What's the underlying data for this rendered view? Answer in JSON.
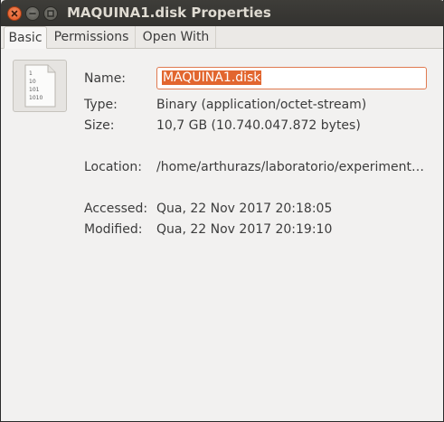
{
  "window": {
    "title": "MAQUINA1.disk Properties"
  },
  "tabs": [
    {
      "label": "Basic",
      "active": true
    },
    {
      "label": "Permissions",
      "active": false
    },
    {
      "label": "Open With",
      "active": false
    }
  ],
  "file_icon": {
    "icon": "binary-file-icon",
    "lines": [
      "1",
      "10",
      "101",
      "1010"
    ]
  },
  "properties": {
    "name_label": "Name:",
    "name_value": "MAQUINA1.disk",
    "type_label": "Type:",
    "type_value": "Binary (application/octet-stream)",
    "size_label": "Size:",
    "size_value": "10,7 GB (10.740.047.872 bytes)",
    "location_label": "Location:",
    "location_value": "/home/arthurazs/laboratorio/experiment…",
    "accessed_label": "Accessed:",
    "accessed_value": "Qua, 22 Nov 2017 20:18:05",
    "modified_label": "Modified:",
    "modified_value": "Qua, 22 Nov 2017 20:19:10"
  },
  "colors": {
    "titlebar": "#3c3b37",
    "close_button": "#e95420",
    "selection": "#e2662f",
    "background": "#f2f1f0"
  }
}
